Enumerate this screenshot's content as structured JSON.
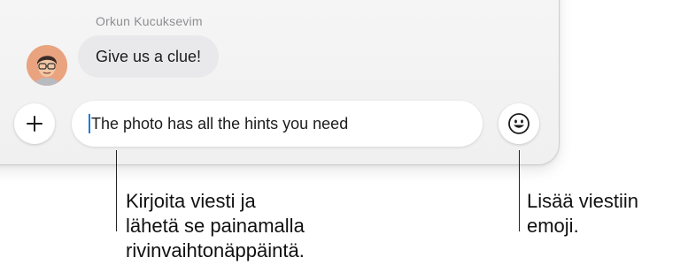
{
  "conversation": {
    "sender_name": "Orkun Kucuksevim",
    "message_text": "Give us a clue!"
  },
  "compose": {
    "draft_text": "The photo has all the hints you need",
    "add_icon": "plus-icon",
    "emoji_icon": "smiley-icon"
  },
  "callouts": {
    "left_lines": [
      "Kirjoita viesti ja",
      "lähetä se painamalla",
      "rivinvaihtonäppäintä."
    ],
    "right_lines": [
      "Lisää viestiin",
      "emoji."
    ]
  }
}
